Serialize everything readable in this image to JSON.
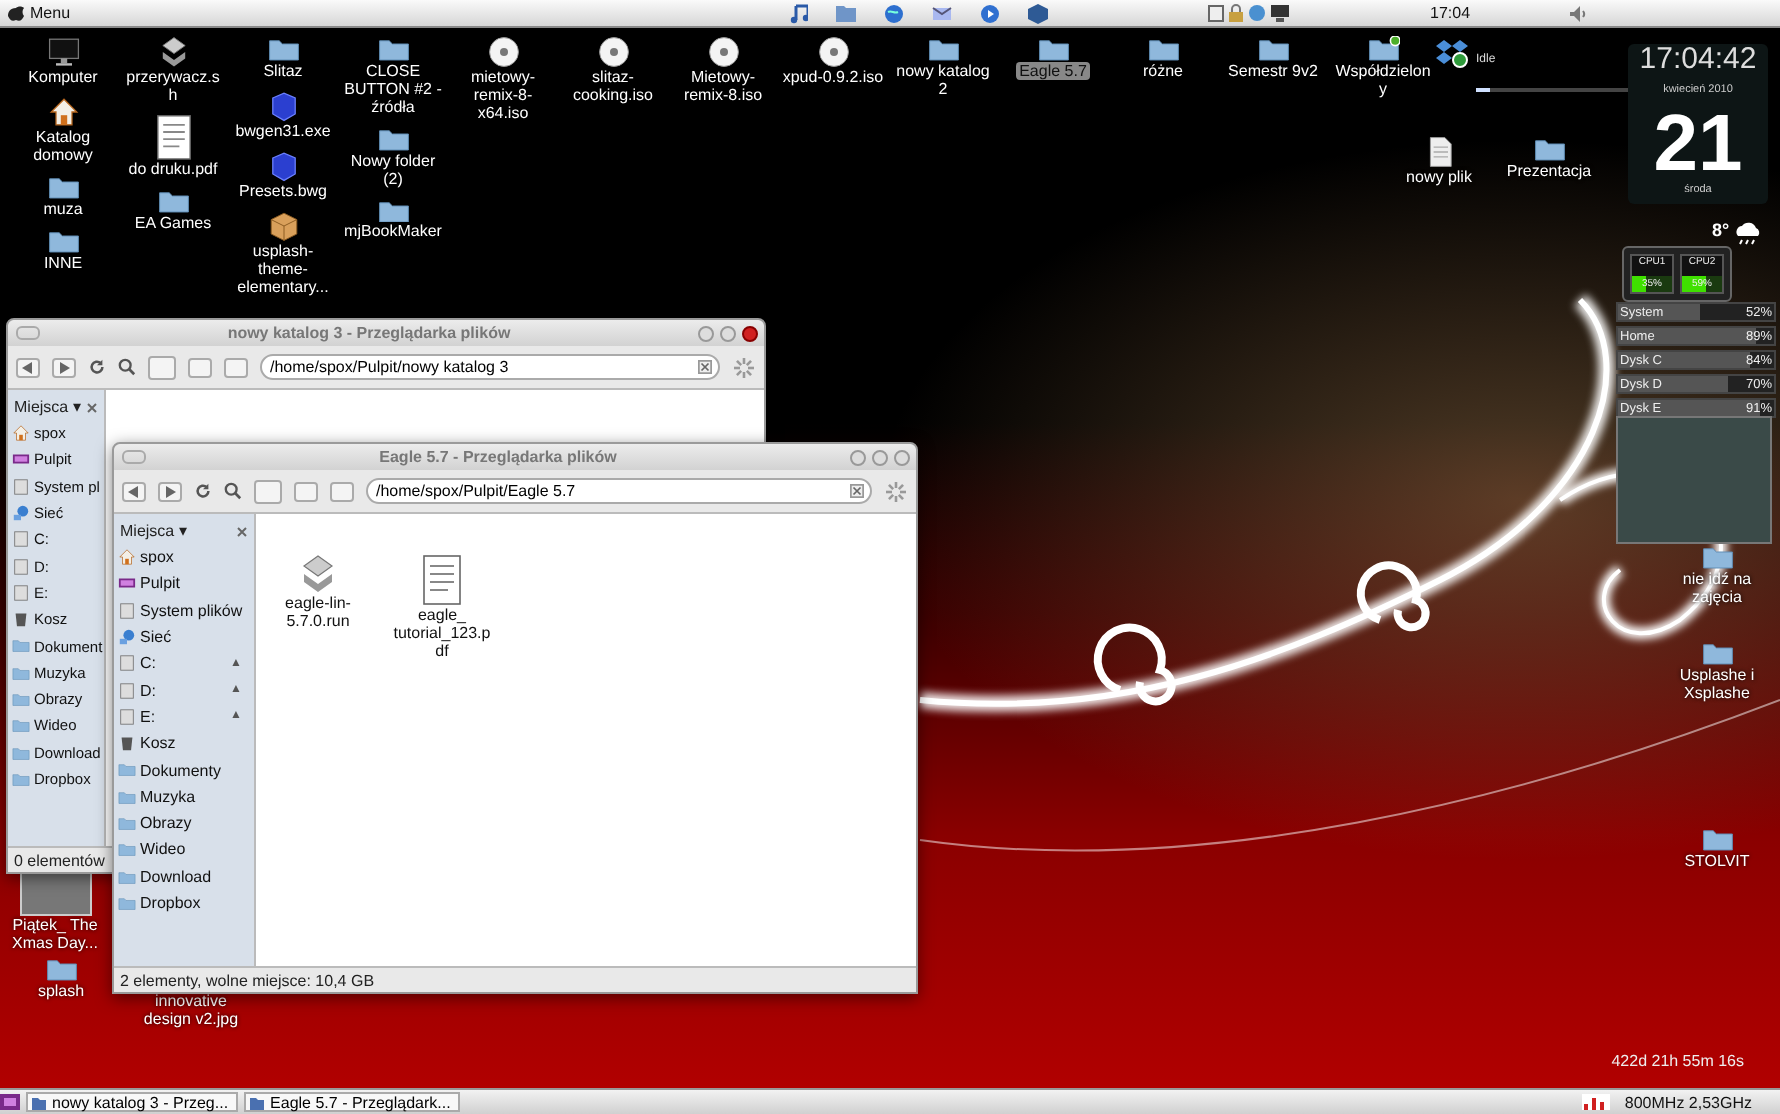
{
  "top_panel": {
    "menu": "Menu",
    "clock": "17:04"
  },
  "desktop": {
    "left_columns": [
      [
        {
          "label": "Komputer",
          "kind": "computer",
          "selected": false
        },
        {
          "label": "Katalog domowy",
          "kind": "home",
          "selected": false
        },
        {
          "label": "muza",
          "kind": "folder",
          "selected": false
        },
        {
          "label": "INNE",
          "kind": "folder",
          "selected": false
        }
      ],
      [
        {
          "label": "przerywacz.sh",
          "kind": "script",
          "selected": false
        },
        {
          "label": "do druku.pdf",
          "kind": "sheet",
          "selected": false
        },
        {
          "label": "EA Games",
          "kind": "folder",
          "selected": false
        }
      ],
      [
        {
          "label": "Slitaz",
          "kind": "folder",
          "selected": false
        },
        {
          "label": "bwgen31.exe",
          "kind": "app",
          "selected": false
        },
        {
          "label": "Presets.bwg",
          "kind": "app",
          "selected": false
        },
        {
          "label": "usplash-theme-elementary...",
          "kind": "package",
          "selected": false
        }
      ],
      [
        {
          "label": "CLOSE BUTTON #2 - źródła",
          "kind": "folder",
          "selected": false
        },
        {
          "label": "Nowy folder (2)",
          "kind": "folder",
          "selected": false
        },
        {
          "label": "mjBookMaker",
          "kind": "folder",
          "selected": false
        }
      ]
    ],
    "top_row": [
      {
        "label": "mietowy-remix-8-x64.iso",
        "kind": "disc",
        "selected": false
      },
      {
        "label": "slitaz-cooking.iso",
        "kind": "disc",
        "selected": false
      },
      {
        "label": "Mietowy-remix-8.iso",
        "kind": "disc",
        "selected": false
      },
      {
        "label": "xpud-0.9.2.iso",
        "kind": "disc",
        "selected": false
      },
      {
        "label": "nowy katalog 2",
        "kind": "folder",
        "selected": false
      },
      {
        "label": "Eagle 5.7",
        "kind": "folder",
        "selected": true
      },
      {
        "label": "różne",
        "kind": "folder",
        "selected": false
      },
      {
        "label": "Semestr 9v2",
        "kind": "folder",
        "selected": false
      },
      {
        "label": "Współdzielony",
        "kind": "shared",
        "selected": false
      }
    ],
    "second_row": [
      {
        "label": "nowy plik",
        "kind": "document",
        "selected": false
      },
      {
        "label": "Prezentacja",
        "kind": "folder",
        "selected": false
      }
    ],
    "right_column": [
      {
        "label": "nie idź na zajęcia",
        "kind": "folder",
        "selected": false
      },
      {
        "label": "Usplashe i Xsplashe",
        "kind": "folder",
        "selected": false
      },
      {
        "label": "STOLVIT",
        "kind": "folder",
        "selected": false
      }
    ],
    "bottom_left": [
      {
        "label": "Piątek_ The Xmas Day...",
        "kind": "photo",
        "selected": false
      },
      {
        "label": "splash",
        "kind": "folder",
        "selected": false
      },
      {
        "label": "innovative design v2.jpg",
        "kind": "hidden",
        "selected": false
      }
    ]
  },
  "widgets": {
    "dropbox": {
      "status": "Idle",
      "level": 0.05
    },
    "clock": {
      "time": "17:04:42",
      "month": "kwiecień 2010",
      "day": "21",
      "weekday": "środa"
    },
    "weather": {
      "temperature": "8°"
    },
    "cpu": [
      {
        "name": "CPU1",
        "reading": "35%",
        "level": 0.35
      },
      {
        "name": "CPU2",
        "reading": "59%",
        "level": 0.59
      }
    ],
    "disks": [
      {
        "name": "System",
        "reading": "52%",
        "level": 0.52
      },
      {
        "name": "Home",
        "reading": "89%",
        "level": 0.89
      },
      {
        "name": "Dysk C",
        "reading": "84%",
        "level": 0.84
      },
      {
        "name": "Dysk D",
        "reading": "70%",
        "level": 0.7
      },
      {
        "name": "Dysk E",
        "reading": "91%",
        "level": 0.91
      }
    ],
    "uptime": "422d 21h 55m 16s"
  },
  "windows": [
    {
      "title": "nowy katalog 3 - Przeglądarka plików",
      "path": "/home/spox/Pulpit/nowy katalog 3",
      "places_title": "Miejsca ▾",
      "places": [
        {
          "label": "spox",
          "kind": "home"
        },
        {
          "label": "Pulpit",
          "kind": "desktop"
        },
        {
          "label": "System pl",
          "kind": "drive"
        },
        {
          "label": "Sieć",
          "kind": "network"
        },
        {
          "label": "C:",
          "kind": "drive"
        },
        {
          "label": "D:",
          "kind": "drive"
        },
        {
          "label": "E:",
          "kind": "drive"
        },
        {
          "label": "Kosz",
          "kind": "trash"
        },
        {
          "label": "Dokument",
          "kind": "folder"
        },
        {
          "label": "Muzyka",
          "kind": "folder"
        },
        {
          "label": "Obrazy",
          "kind": "folder"
        },
        {
          "label": "Wideo",
          "kind": "folder"
        },
        {
          "label": "Download",
          "kind": "folder"
        },
        {
          "label": "Dropbox",
          "kind": "folder"
        }
      ],
      "status": "0 elementów"
    },
    {
      "title": "Eagle 5.7 - Przeglądarka plików",
      "path": "/home/spox/Pulpit/Eagle 5.7",
      "places_title": "Miejsca ▾",
      "eject_glyph": "▲",
      "places": [
        {
          "label": "spox",
          "kind": "home",
          "eject": false
        },
        {
          "label": "Pulpit",
          "kind": "desktop",
          "eject": false
        },
        {
          "label": "System plików",
          "kind": "drive",
          "eject": false
        },
        {
          "label": "Sieć",
          "kind": "network",
          "eject": false
        },
        {
          "label": "C:",
          "kind": "drive",
          "eject": true
        },
        {
          "label": "D:",
          "kind": "drive",
          "eject": true
        },
        {
          "label": "E:",
          "kind": "drive",
          "eject": true
        },
        {
          "label": "Kosz",
          "kind": "trash",
          "eject": false
        },
        {
          "label": "Dokumenty",
          "kind": "folder",
          "eject": false
        },
        {
          "label": "Muzyka",
          "kind": "folder",
          "eject": false
        },
        {
          "label": "Obrazy",
          "kind": "folder",
          "eject": false
        },
        {
          "label": "Wideo",
          "kind": "folder",
          "eject": false
        },
        {
          "label": "Download",
          "kind": "folder",
          "eject": false
        },
        {
          "label": "Dropbox",
          "kind": "folder",
          "eject": false
        }
      ],
      "files": [
        {
          "label": "eagle-lin-5.7.0.run",
          "kind": "script"
        },
        {
          "label": "eagle_ tutorial_123.pdf",
          "kind": "sheet"
        }
      ],
      "status": "2 elementy, wolne miejsce: 10,4 GB"
    }
  ],
  "taskbar": {
    "tasks": [
      "nowy katalog 3 - Przeg...",
      "Eagle 5.7 - Przeglądark..."
    ],
    "cpu_freq": "800MHz 2,53GHz"
  }
}
